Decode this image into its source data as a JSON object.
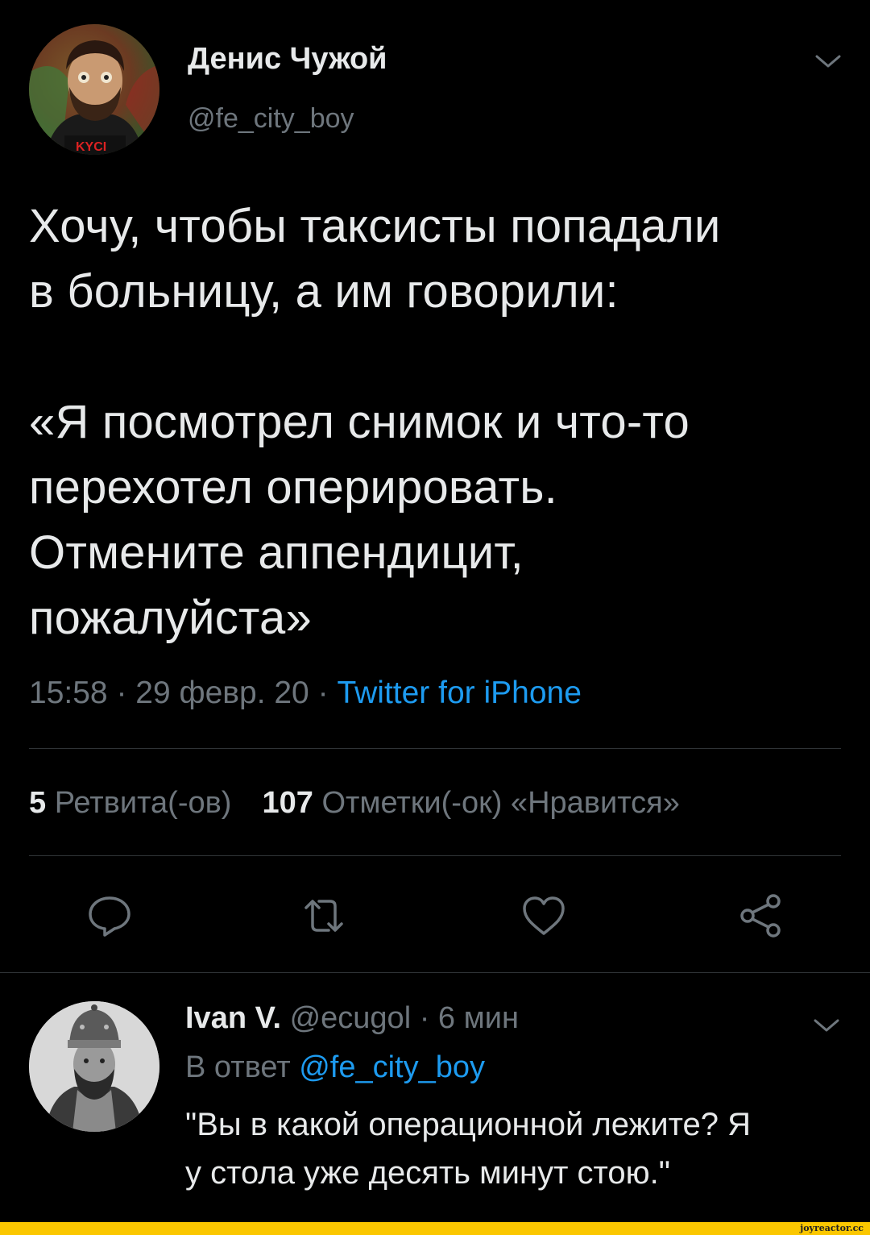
{
  "tweet": {
    "author_name": "Денис Чужой",
    "author_handle": "@fe_city_boy",
    "text": "Хочу, чтобы таксисты попадали\nв больницу, а им говорили:\n\n«Я посмотрел снимок и что-то\nперехотел оперировать.\nОтмените аппендицит,\nпожалуйста»",
    "time": "15:58",
    "date": "29 февр. 20",
    "separator": "·",
    "source": "Twitter for iPhone",
    "retweets_count": "5",
    "retweets_label": "Ретвита(-ов)",
    "likes_count": "107",
    "likes_label": "Отметки(-ок) «Нравится»",
    "avatar_shirt_text": "KYCI"
  },
  "actions": {
    "reply_icon": "reply-icon",
    "retweet_icon": "retweet-icon",
    "like_icon": "heart-icon",
    "share_icon": "share-icon"
  },
  "reply": {
    "author_name": "Ivan V.",
    "author_handle": "@ecugol",
    "separator": "·",
    "time_ago": "6 мин",
    "in_reply_label": "В ответ",
    "in_reply_mention": "@fe_city_boy",
    "text": "\"Вы в какой операционной лежите? Я\nу стола уже десять минут стою.\""
  },
  "watermark": "joyreactor.cc",
  "colors": {
    "background": "#000000",
    "text": "#e7e9ea",
    "muted": "#6e767d",
    "accent": "#1d9bf0",
    "divider": "#2f3336",
    "watermark_bar": "#fbc700"
  }
}
